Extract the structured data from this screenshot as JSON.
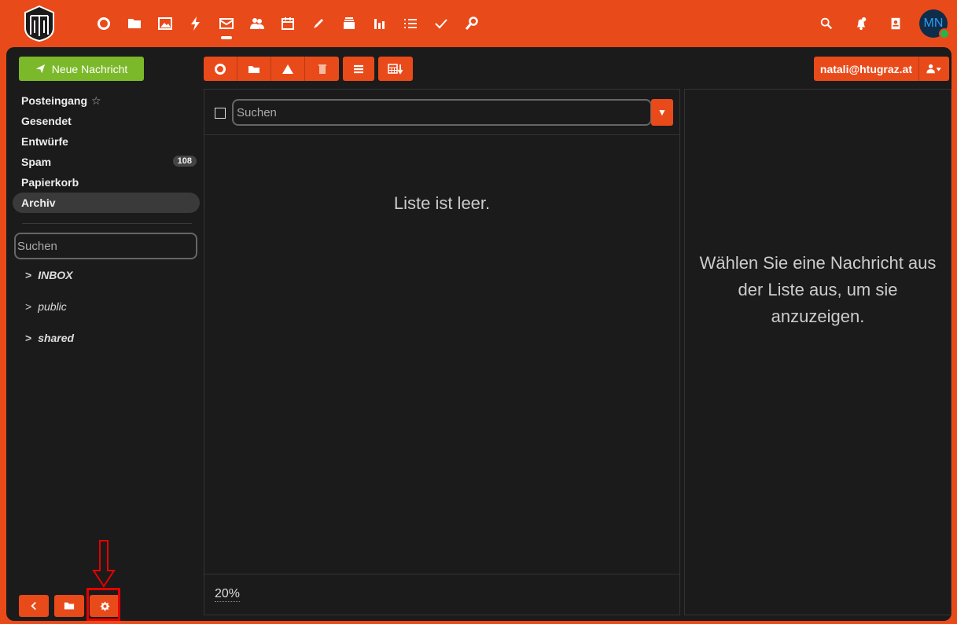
{
  "topnav": {
    "items": [
      {
        "name": "dashboard-icon"
      },
      {
        "name": "files-icon"
      },
      {
        "name": "photos-icon"
      },
      {
        "name": "activity-icon"
      },
      {
        "name": "mail-icon",
        "active": true
      },
      {
        "name": "contacts-icon"
      },
      {
        "name": "calendar-icon"
      },
      {
        "name": "notes-icon"
      },
      {
        "name": "deck-icon"
      },
      {
        "name": "analytics-icon"
      },
      {
        "name": "tasks-icon"
      },
      {
        "name": "checks-icon"
      },
      {
        "name": "passwords-icon"
      }
    ],
    "avatar_initials": "MN"
  },
  "sidebar": {
    "new_message_label": "Neue Nachricht",
    "folders": [
      {
        "label": "Posteingang",
        "star": "☆"
      },
      {
        "label": "Gesendet"
      },
      {
        "label": "Entwürfe"
      },
      {
        "label": "Spam",
        "count": "108"
      },
      {
        "label": "Papierkorb"
      },
      {
        "label": "Archiv",
        "selected": true
      }
    ],
    "search_placeholder": "Suchen",
    "tree": [
      {
        "label": "INBOX"
      },
      {
        "label": "public"
      },
      {
        "label": "shared"
      }
    ]
  },
  "account": {
    "email": "natali@htugraz.at"
  },
  "list": {
    "search_placeholder": "Suchen",
    "empty_text": "Liste ist leer.",
    "zoom": "20%"
  },
  "preview": {
    "message": "Wählen Sie eine Nachricht aus der Liste aus, um sie anzuzeigen."
  },
  "colors": {
    "accent": "#e94a1a",
    "background": "#1b1b1b",
    "new_message": "#7bb82a"
  }
}
